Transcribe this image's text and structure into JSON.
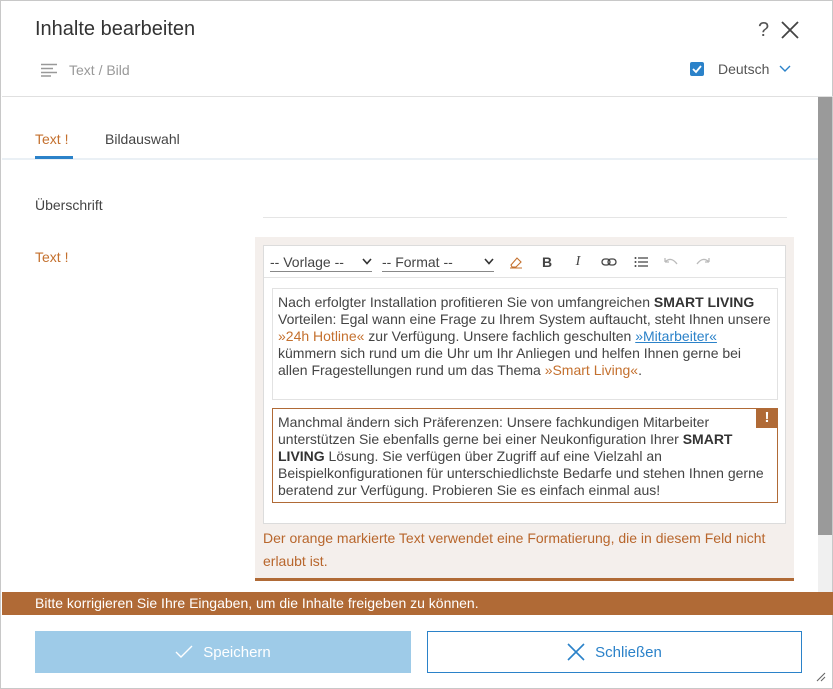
{
  "header": {
    "title": "Inhalte bearbeiten",
    "help": "?",
    "subtitle": "Text / Bild",
    "language": {
      "label": "Deutsch",
      "checked": true
    }
  },
  "tabs": [
    {
      "label": "Text !",
      "active": true
    },
    {
      "label": "Bildauswahl",
      "active": false
    }
  ],
  "form": {
    "heading_label": "Überschrift",
    "heading_value": "",
    "text_label": "Text !"
  },
  "editor": {
    "template_select": "-- Vorlage --",
    "format_select": "-- Format --",
    "toolbar_icons": [
      "eraser-icon",
      "bold-icon",
      "italic-icon",
      "link-icon",
      "list-icon",
      "undo-icon",
      "redo-icon"
    ],
    "bold_label": "B",
    "italic_label": "I",
    "paragraph1": {
      "t1": "Nach erfolgter Installation profitieren Sie von umfangreichen ",
      "b1": "SMART LIVING",
      "t2": " Vorteilen: Egal wann eine Frage zu Ihrem System auftaucht, steht Ihnen unsere ",
      "link1": "»24h Hotline«",
      "t3": " zur Verfügung. Unsere fachlich geschulten ",
      "link2": "»Mitarbeiter«",
      "t4": " kümmern sich rund um die Uhr um Ihr Anliegen und helfen Ihnen gerne bei allen Fragestellungen rund um das Thema ",
      "link3": "»Smart Living«",
      "t5": "."
    },
    "paragraph2": {
      "t1": "Manchmal ändern sich Präferenzen: Unsere fachkundigen Mitarbeiter unterstützen Sie ebenfalls gerne bei einer Neukonfiguration Ihrer ",
      "b1": "SMART LIVING",
      "t2": " Lösung. Sie verfügen über Zugriff auf eine Vielzahl an Beispielkonfigurationen für unterschiedlichste Bedarfe und stehen Ihnen gerne beratend zur Verfügung. Probieren Sie es einfach einmal aus!",
      "warning_mark": "!"
    },
    "error": "Der orange markierte Text verwendet eine Formatierung, die in diesem Feld nicht erlaubt ist."
  },
  "footer": {
    "banner": "Bitte korrigieren Sie Ihre Eingaben, um die Inhalte freigeben zu können.",
    "save_label": "Speichern",
    "close_label": "Schließen"
  },
  "colors": {
    "accent": "#2b82c9",
    "warning": "#b06a36",
    "warning_text": "#c4702e",
    "save_disabled": "#9ecbe8"
  }
}
